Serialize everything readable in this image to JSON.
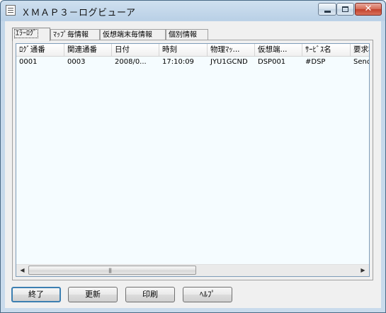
{
  "window": {
    "title": "ＸＭＡＰ３－ログビューア",
    "controls": {
      "minimize": "minimize",
      "maximize": "maximize",
      "close": "✕"
    }
  },
  "tabs": [
    {
      "label": "ｴﾗｰﾛｸﾞ",
      "active": true
    },
    {
      "label": "ﾏｯﾌﾟ毎情報",
      "active": false
    },
    {
      "label": "仮想端末毎情報",
      "active": false
    },
    {
      "label": "個別情報",
      "active": false
    }
  ],
  "list": {
    "columns": [
      "ﾛｸﾞ通番",
      "関連通番",
      "日付",
      "時刻",
      "物理ﾏｯ...",
      "仮想端...",
      "ｻｰﾋﾞｽ名",
      "要求種"
    ],
    "rows": [
      [
        "0001",
        "0003",
        "2008/0...",
        "17:10:09",
        "JYU1GCND",
        "DSP001",
        "#DSP",
        "Send"
      ]
    ]
  },
  "scrollbar": {
    "left_arrow": "◀",
    "right_arrow": "▶",
    "grip": "|||"
  },
  "buttons": {
    "exit": "終了",
    "refresh": "更新",
    "print": "印刷",
    "help": "ﾍﾙﾌﾟ"
  }
}
